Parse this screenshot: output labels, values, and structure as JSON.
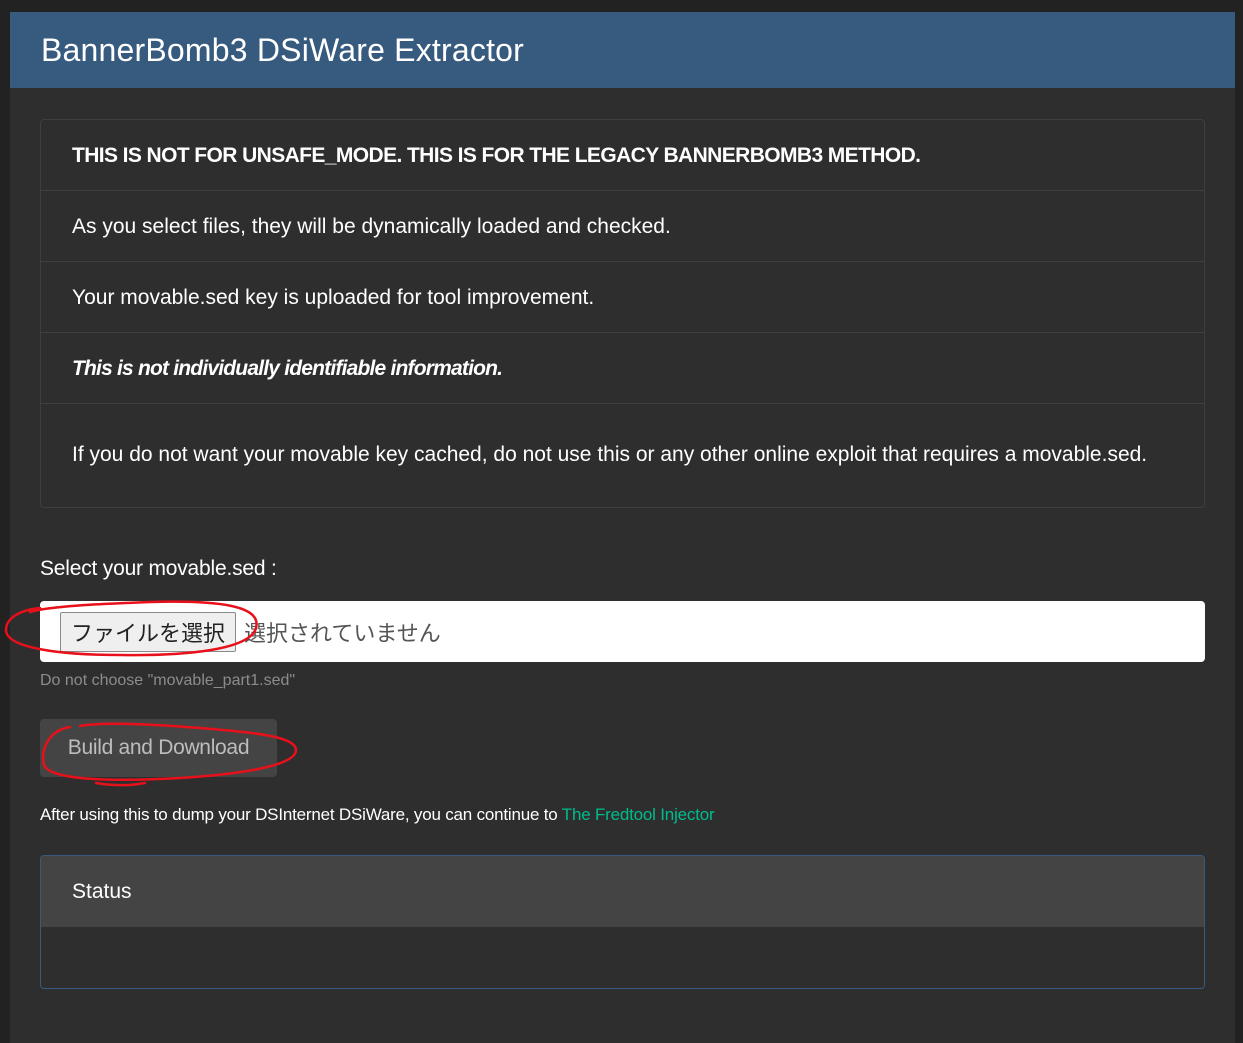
{
  "header": {
    "title": "BannerBomb3 DSiWare Extractor"
  },
  "notices": [
    "THIS IS NOT FOR UNSAFE_MODE. THIS IS FOR THE LEGACY BANNERBOMB3 METHOD.",
    "As you select files, they will be dynamically loaded and checked.",
    "Your movable.sed key is uploaded for tool improvement.",
    "This is not individually identifiable information.",
    "If you do not want your movable key cached, do not use this or any other online exploit that requires a movable.sed."
  ],
  "form": {
    "label": "Select your movable.sed :",
    "file_button": "ファイルを選択",
    "file_status": "選択されていません",
    "help": "Do not choose \"movable_part1.sed\"",
    "build_button": "Build and Download"
  },
  "after": {
    "text": "After using this to dump your DSInternet DSiWare, you can continue to",
    "link": "The Fredtool Injector"
  },
  "status": {
    "title": "Status",
    "body": ""
  },
  "colors": {
    "header": "#375a7f",
    "link": "#00bc8c",
    "annotation": "#e8101a"
  }
}
